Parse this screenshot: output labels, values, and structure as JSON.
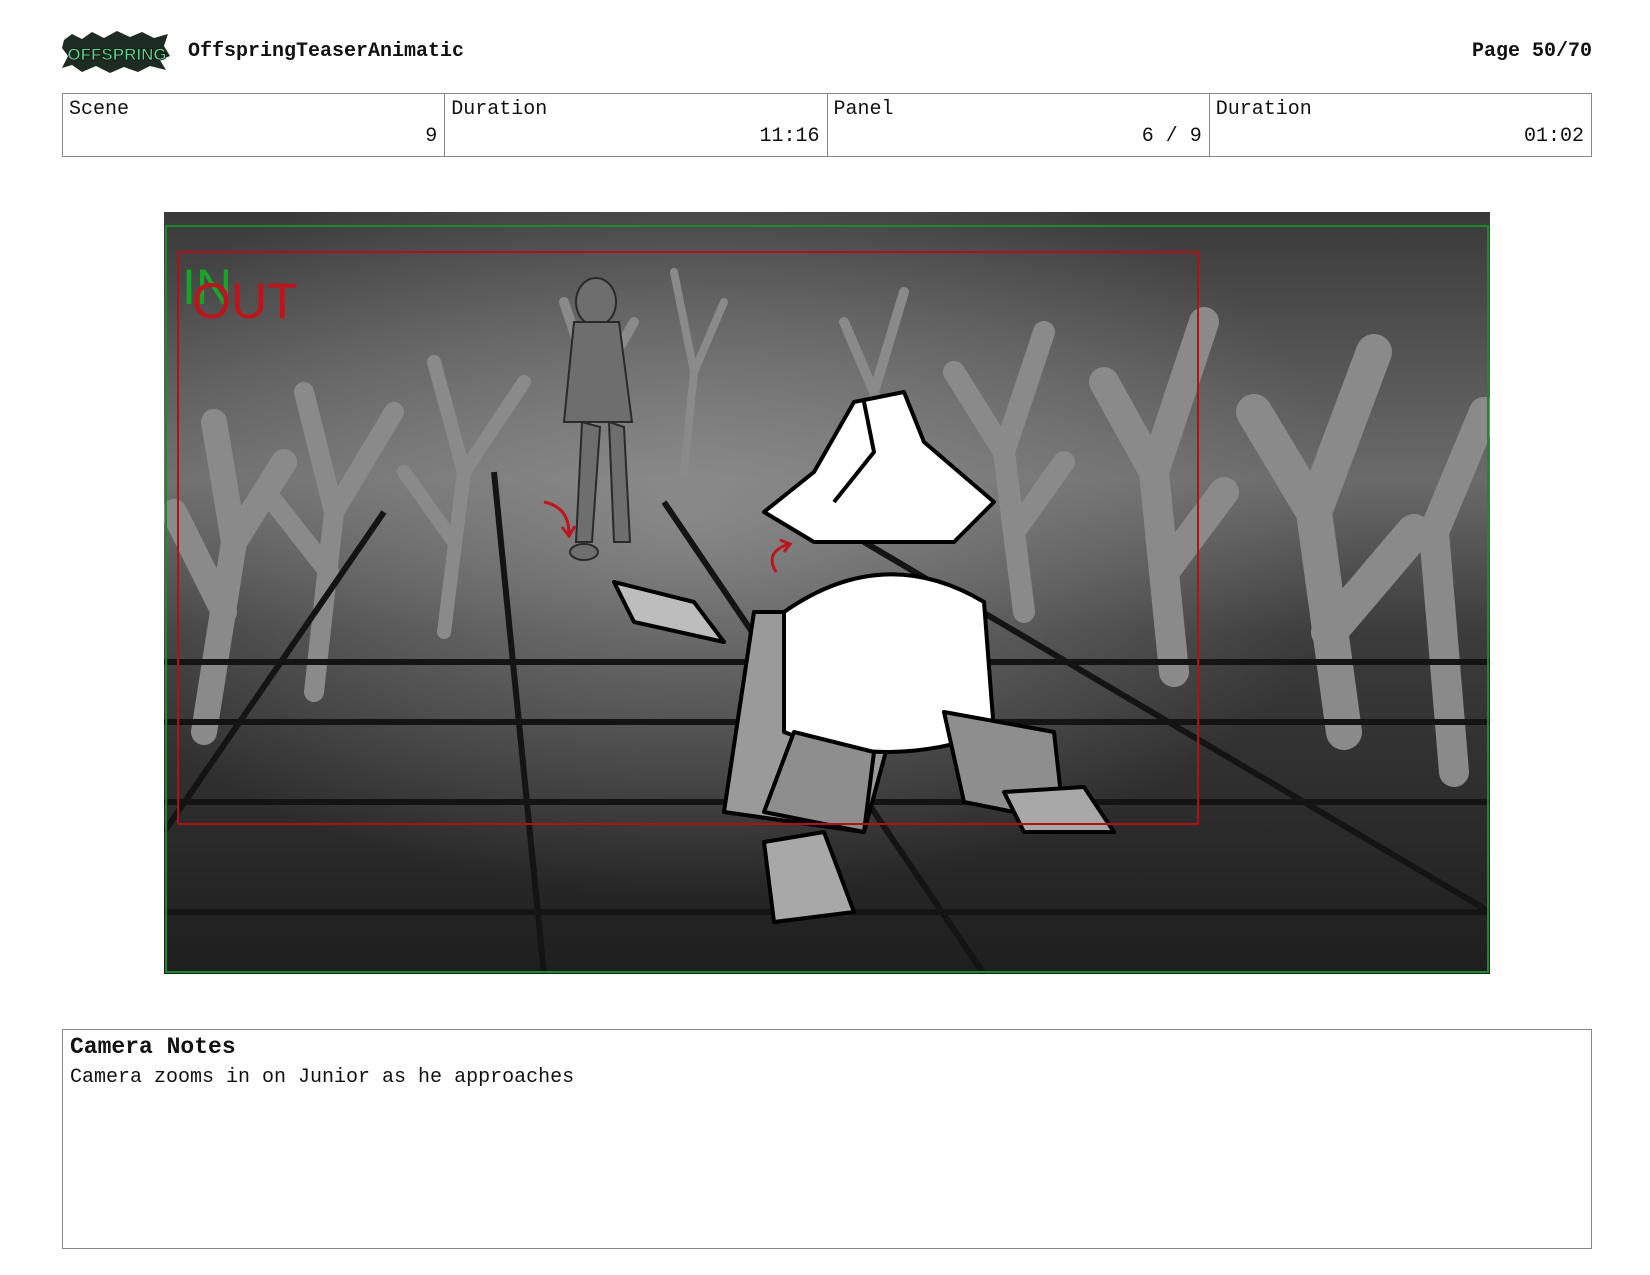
{
  "header": {
    "logo_alt": "OFFSPRING",
    "project_title": "OffspringTeaserAnimatic",
    "page": "Page 50/70"
  },
  "info": [
    {
      "label": "Scene",
      "value": "9"
    },
    {
      "label": "Duration",
      "value": "11:16"
    },
    {
      "label": "Panel",
      "value": "6 / 9"
    },
    {
      "label": "Duration",
      "value": "01:02"
    }
  ],
  "frame": {
    "in_label": "IN",
    "out_label": "OUT",
    "colors": {
      "in": "#1aa32a",
      "out": "#c0141c",
      "safe_frame": "#1a8a2a",
      "action_frame": "#b01018"
    }
  },
  "notes": {
    "title": "Camera Notes",
    "text": "Camera zooms in on Junior as he approaches"
  }
}
